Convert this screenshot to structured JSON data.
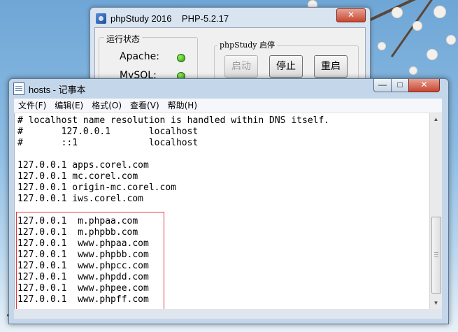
{
  "php_window": {
    "title": "phpStudy 2016    PHP-5.2.17",
    "close": "✕",
    "status_group": "运行状态",
    "services": [
      {
        "name": "Apache:",
        "status_color": "#2a9a14"
      },
      {
        "name": "MySQL:",
        "status_color": "#2a9a14"
      }
    ],
    "control_group": "phpStudy 启停",
    "buttons": {
      "start": "启动",
      "stop": "停止",
      "restart": "重启"
    }
  },
  "notepad": {
    "title": "hosts - 记事本",
    "controls": {
      "minimize": "—",
      "maximize": "□",
      "close": "✕"
    },
    "menu": [
      "文件(F)",
      "编辑(E)",
      "格式(O)",
      "查看(V)",
      "帮助(H)"
    ],
    "lines": [
      "# localhost name resolution is handled within DNS itself.",
      "#       127.0.0.1       localhost",
      "#       ::1             localhost",
      "",
      "127.0.0.1 apps.corel.com",
      "127.0.0.1 mc.corel.com",
      "127.0.0.1 origin-mc.corel.com",
      "127.0.0.1 iws.corel.com",
      "",
      "127.0.0.1  m.phpaa.com",
      "127.0.0.1  m.phpbb.com",
      "127.0.0.1  www.phpaa.com",
      "127.0.0.1  www.phpbb.com",
      "127.0.0.1  www.phpcc.com",
      "127.0.0.1  www.phpdd.com",
      "127.0.0.1  www.phpee.com",
      "127.0.0.1  www.phpff.com"
    ],
    "highlight_color": "#e03c3c",
    "scrollbar": {
      "up": "▲",
      "down": "▼"
    }
  }
}
